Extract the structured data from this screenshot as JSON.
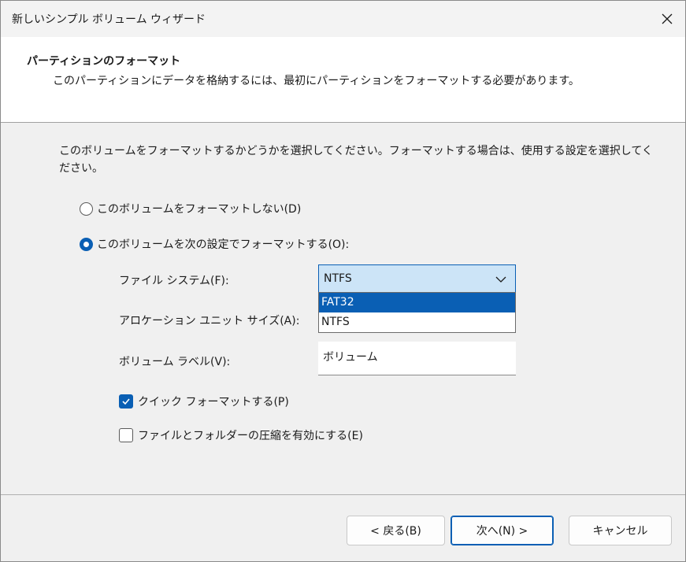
{
  "window": {
    "title": "新しいシンプル ボリューム ウィザード"
  },
  "header": {
    "title": "パーティションのフォーマット",
    "subtitle": "このパーティションにデータを格納するには、最初にパーティションをフォーマットする必要があります。"
  },
  "content": {
    "description": "このボリュームをフォーマットするかどうかを選択してください。フォーマットする場合は、使用する設定を選択してください。",
    "radio_no_format": {
      "label": "このボリュームをフォーマットしない(D)",
      "checked": false
    },
    "radio_format": {
      "label": "このボリュームを次の設定でフォーマットする(O):",
      "checked": true
    },
    "file_system": {
      "label": "ファイル システム(F):",
      "value": "NTFS",
      "options": [
        {
          "label": "FAT32",
          "highlighted": true
        },
        {
          "label": "NTFS",
          "highlighted": false
        }
      ]
    },
    "allocation_unit": {
      "label": "アロケーション ユニット サイズ(A):"
    },
    "volume_label": {
      "label": "ボリューム ラベル(V):",
      "value": "ボリューム"
    },
    "quick_format": {
      "label": "クイック フォーマットする(P)",
      "checked": true
    },
    "compression": {
      "label": "ファイルとフォルダーの圧縮を有効にする(E)",
      "checked": false
    }
  },
  "footer": {
    "back_label": "< 戻る(B)",
    "next_label": "次へ(N) >",
    "cancel_label": "キャンセル"
  },
  "colors": {
    "accent": "#0a5fb4",
    "select_bg": "#cce4f7"
  }
}
